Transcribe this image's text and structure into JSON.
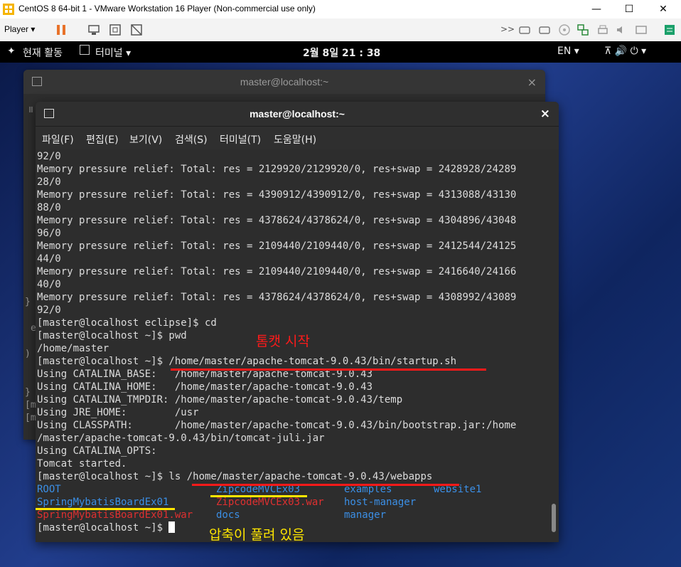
{
  "vmware": {
    "title": "CentOS 8 64-bit 1 - VMware Workstation 16 Player (Non-commercial use only)",
    "player_menu": "Player ▾",
    "min": "—",
    "max": "☐",
    "close": "✕"
  },
  "gnome": {
    "activities": "현재 활동",
    "app_menu": "터미널 ▾",
    "clock": "2월 8일  21 : 38",
    "lang": "EN ▾",
    "tray": "⊼ 🔊 ⏻ ▾"
  },
  "back_terminal": {
    "title": "master@localhost:~",
    "close": "×",
    "fragments": [
      "॥",
      "}",
      "e",
      ")",
      "}",
      "[m",
      "[m"
    ]
  },
  "front_terminal": {
    "title": "master@localhost:~",
    "close": "×",
    "menu": [
      "파일(F)",
      "편집(E)",
      "보기(V)",
      "검색(S)",
      "터미널(T)",
      "도움말(H)"
    ],
    "lines": [
      "92/0",
      "Memory pressure relief: Total: res = 2129920/2129920/0, res+swap = 2428928/24289",
      "28/0",
      "Memory pressure relief: Total: res = 4390912/4390912/0, res+swap = 4313088/43130",
      "88/0",
      "Memory pressure relief: Total: res = 4378624/4378624/0, res+swap = 4304896/43048",
      "96/0",
      "Memory pressure relief: Total: res = 2109440/2109440/0, res+swap = 2412544/24125",
      "44/0",
      "Memory pressure relief: Total: res = 2109440/2109440/0, res+swap = 2416640/24166",
      "40/0",
      "Memory pressure relief: Total: res = 4378624/4378624/0, res+swap = 4308992/43089",
      "92/0",
      "[master@localhost eclipse]$ cd",
      "[master@localhost ~]$ pwd",
      "/home/master",
      "[master@localhost ~]$ /home/master/apache-tomcat-9.0.43/bin/startup.sh",
      "Using CATALINA_BASE:   /home/master/apache-tomcat-9.0.43",
      "Using CATALINA_HOME:   /home/master/apache-tomcat-9.0.43",
      "Using CATALINA_TMPDIR: /home/master/apache-tomcat-9.0.43/temp",
      "Using JRE_HOME:        /usr",
      "Using CLASSPATH:       /home/master/apache-tomcat-9.0.43/bin/bootstrap.jar:/home",
      "/master/apache-tomcat-9.0.43/bin/tomcat-juli.jar",
      "Using CATALINA_OPTS:",
      "Tomcat started.",
      "[master@localhost ~]$ ls /home/master/apache-tomcat-9.0.43/webapps"
    ],
    "ls_row1": [
      "ROOT",
      "ZipcodeMVCEx03",
      "examples",
      "website1"
    ],
    "ls_row2": [
      "SpringMybatisBoardEx01",
      "ZipcodeMVCEx03.war",
      "host-manager"
    ],
    "ls_row3": [
      "SpringMybatisBoardEx01.war",
      "docs",
      "manager"
    ],
    "prompt": "[master@localhost ~]$ "
  },
  "annotations": {
    "start": "톰캣 시작",
    "unzipped": "압축이 풀려 있음"
  },
  "colors": {
    "dir_blue": "#3b8fe6",
    "war_red": "#e03030",
    "annot_red": "#ff1a1a",
    "annot_yellow": "#ffe600"
  }
}
